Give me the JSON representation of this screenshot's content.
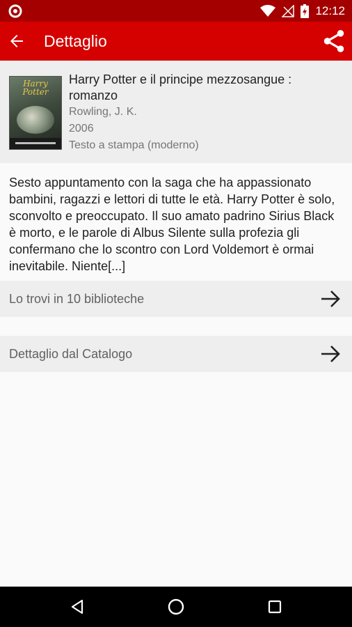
{
  "status_bar": {
    "time": "12:12",
    "icons": [
      "circle-notification-icon",
      "wifi-icon",
      "no-signal-icon",
      "battery-charging-icon"
    ]
  },
  "app_bar": {
    "title": "Dettaglio",
    "back_icon": "arrow-back-icon",
    "share_icon": "share-icon",
    "background": "#d50000",
    "status_background": "#a50000"
  },
  "book": {
    "cover_title": "Harry Potter",
    "title": "Harry Potter e il principe mezzosangue : romanzo",
    "author": "Rowling, J. K.",
    "year": "2006",
    "type": "Testo a stampa (moderno)"
  },
  "description": "Sesto appuntamento con la saga che ha appassionato bambini, ragazzi e lettori di tutte le età. Harry Potter è solo, sconvolto e preoccupato. Il suo amato padrino Sirius Black è morto, e le parole di Albus Silente sulla profezia gli confermano che lo scontro con Lord Voldemort è ormai inevitabile. Niente[...]",
  "rows": [
    {
      "label": "Lo trovi in 10 biblioteche",
      "icon": "arrow-forward-icon"
    },
    {
      "label": "Dettaglio dal Catalogo",
      "icon": "arrow-forward-icon"
    }
  ],
  "nav_bar": {
    "buttons": [
      "back-triangle-icon",
      "home-circle-icon",
      "recents-square-icon"
    ]
  }
}
